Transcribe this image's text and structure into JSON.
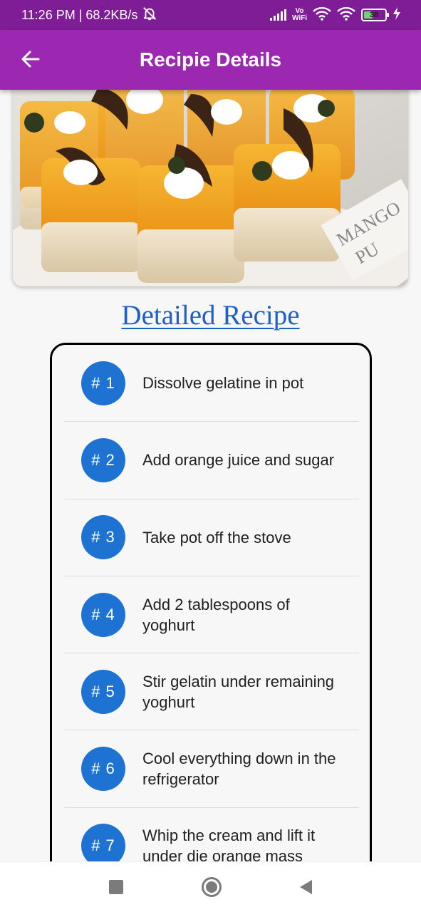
{
  "status_bar": {
    "time_speed": "11:26 PM | 68.2KB/s",
    "vowifi_line1": "Vo",
    "vowifi_line2": "WiFi",
    "battery_level": "38",
    "icons": [
      "mute-bell-icon",
      "signal-icon",
      "vowifi-icon",
      "wifi-icon",
      "wifi-icon",
      "battery-icon",
      "charging-icon"
    ]
  },
  "app_bar": {
    "title": "Recipie Details",
    "back_icon": "arrow-left-icon"
  },
  "hero": {
    "sign_line1": "MANGO",
    "sign_line2": "PU"
  },
  "heading": "Detailed Recipe",
  "steps": [
    {
      "number": "# 1",
      "text": "Dissolve gelatine in pot"
    },
    {
      "number": "# 2",
      "text": "Add orange juice and sugar"
    },
    {
      "number": "# 3",
      "text": "Take pot off the stove"
    },
    {
      "number": "# 4",
      "text": "Add 2 tablespoons of yoghurt"
    },
    {
      "number": "# 5",
      "text": "Stir gelatin under remaining yoghurt"
    },
    {
      "number": "# 6",
      "text": "Cool everything down in the refrigerator"
    },
    {
      "number": "# 7",
      "text": "Whip the cream and lift it under die orange mass"
    }
  ],
  "nav_bar": {
    "icons": [
      "recents-square-icon",
      "home-circle-icon",
      "back-triangle-icon"
    ]
  },
  "colors": {
    "status_bar": "#7e1d96",
    "app_bar": "#9c27b0",
    "badge": "#1e73d2",
    "heading": "#1d5fc9"
  }
}
